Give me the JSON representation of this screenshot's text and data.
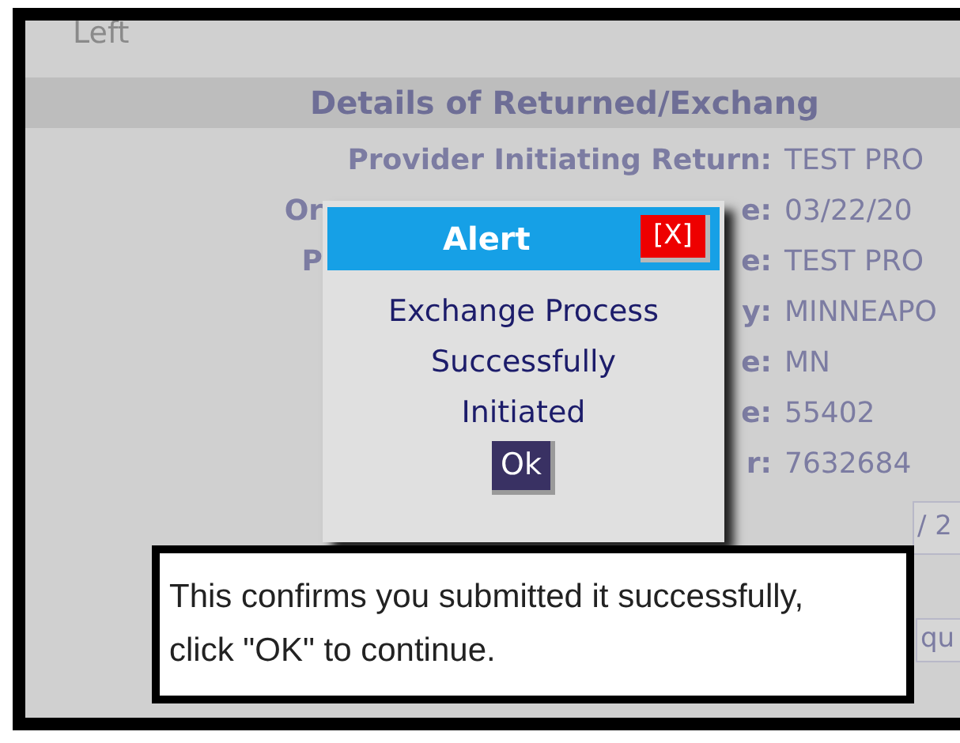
{
  "page": {
    "top_link": "Left",
    "section_title": "Details of Returned/Exchang",
    "rows": [
      {
        "label": "Provider Initiating Return:",
        "value": "TEST PRO"
      },
      {
        "label_left": "Or",
        "label_right": "e:",
        "value": "03/22/20"
      },
      {
        "label_left": "P",
        "label_right": "e:",
        "value": "TEST PRO"
      },
      {
        "label_right": "y:",
        "value": "MINNEAPO"
      },
      {
        "label_right": "e:",
        "value": "MN"
      },
      {
        "label_right": "e:",
        "value": "55402"
      },
      {
        "label_right": "r:",
        "value": "7632684"
      }
    ],
    "field_value": "/ 2",
    "button_label": "qu"
  },
  "dialog": {
    "title": "Alert",
    "close_label": "[X]",
    "message": "Exchange Process Successfully Initiated",
    "ok_label": "Ok"
  },
  "callout": {
    "text": "This confirms you submitted it successfully, click \"OK\" to continue."
  }
}
